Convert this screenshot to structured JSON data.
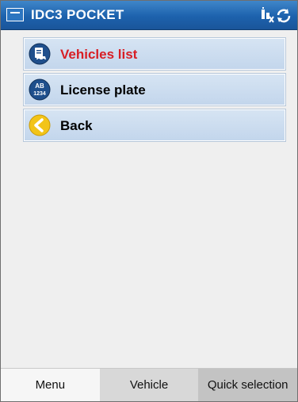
{
  "app": {
    "title": "IDC3 POCKET"
  },
  "menu": {
    "items": [
      {
        "label": "Vehicles list",
        "icon": "vehicles-list-icon",
        "color": "#d81e25"
      },
      {
        "label": "License plate",
        "icon": "license-plate-icon",
        "icon_text_top": "AB",
        "icon_text_bottom": "1234",
        "color": "#000000"
      },
      {
        "label": "Back",
        "icon": "back-arrow-icon",
        "color": "#000000"
      }
    ]
  },
  "tabs": [
    {
      "label": "Menu"
    },
    {
      "label": "Vehicle"
    },
    {
      "label": "Quick selection"
    }
  ],
  "colors": {
    "titlebar": "#1d62ad",
    "menu_item_bg": "#c8d9ee",
    "active_label": "#d81e25"
  }
}
